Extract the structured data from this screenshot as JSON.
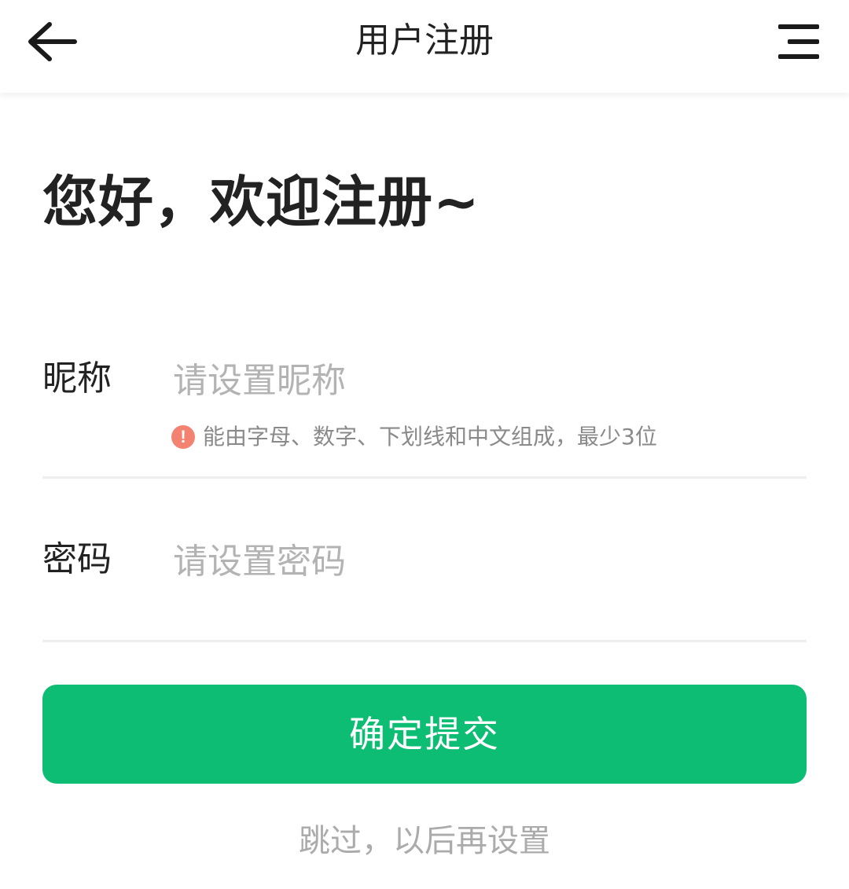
{
  "header": {
    "title": "用户注册",
    "back_icon": "arrow-left-icon",
    "menu_icon": "menu-icon"
  },
  "welcome": "您好，欢迎注册~",
  "form": {
    "nickname": {
      "label": "昵称",
      "placeholder": "请设置昵称",
      "value": "",
      "hint": "能由字母、数字、下划线和中文组成，最少3位",
      "hint_icon": "warning-icon"
    },
    "password": {
      "label": "密码",
      "placeholder": "请设置密码",
      "value": ""
    }
  },
  "submit_label": "确定提交",
  "skip_label": "跳过，以后再设置",
  "colors": {
    "accent": "#0dbd73",
    "hint_icon": "#f48270",
    "placeholder": "#b3b3b3"
  }
}
